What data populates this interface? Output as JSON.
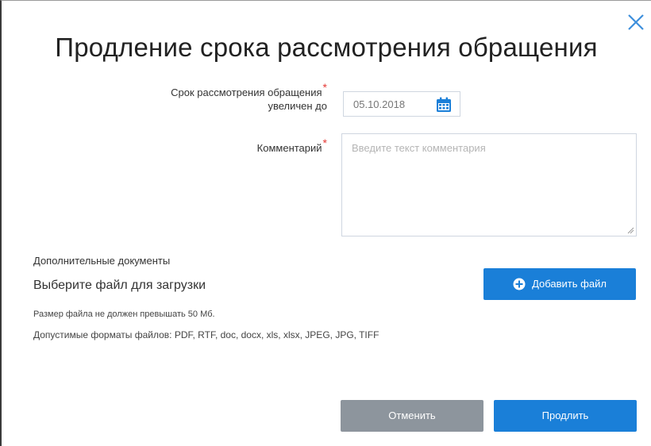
{
  "dialog": {
    "title": "Продление срока рассмотрения обращения",
    "date_label_line1": "Срок рассмотрения обращения",
    "date_label_line2": "увеличен до",
    "date_value": "05.10.2018",
    "comment_label": "Комментарий",
    "comment_placeholder": "Введите текст комментария",
    "required_mark": "*",
    "extra_docs_label": "Дополнительные документы",
    "choose_file_text": "Выберите файл для загрузки",
    "add_file_button": "Добавить файл",
    "file_size_hint": "Размер файла не должен превышать 50 Мб.",
    "file_formats_hint": "Допустимые форматы файлов: PDF, RTF, doc, docx, xls, xlsx, JPEG, JPG, TIFF",
    "cancel_button": "Отменить",
    "extend_button": "Продлить"
  },
  "icons": {
    "close": "close-icon",
    "calendar": "calendar-icon",
    "add": "plus-circle-icon"
  },
  "colors": {
    "primary": "#1a7fd8",
    "secondary": "#8d959d",
    "required": "#e53935"
  }
}
